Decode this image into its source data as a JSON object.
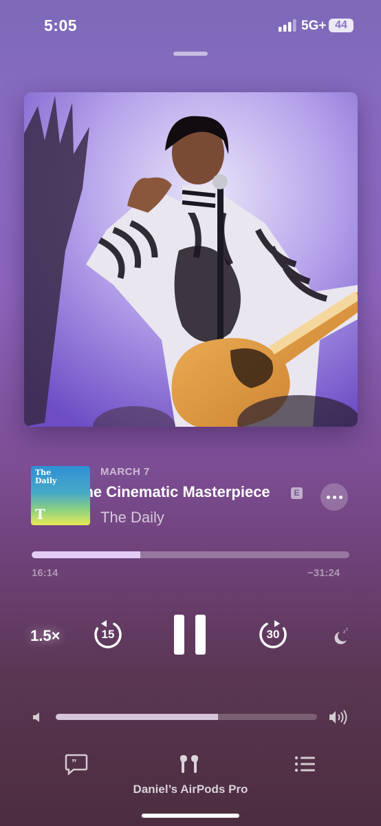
{
  "status_bar": {
    "time": "5:05",
    "network": "5G+",
    "battery": "44",
    "icons": [
      "signal-bars-icon",
      "battery-icon"
    ]
  },
  "artwork": {
    "description_icon": "album-artwork-image"
  },
  "episode": {
    "date": "MARCH 7",
    "title": "The Cinematic Masterpiece",
    "explicit_badge": "E",
    "show": "The Daily",
    "thumbnail_title": "The\nDaily",
    "thumbnail_logo": "T"
  },
  "progress": {
    "elapsed": "16:14",
    "remaining": "−31:24",
    "fraction": 0.341
  },
  "controls": {
    "speed": "1.5×",
    "skip_back": "15",
    "skip_forward": "30",
    "icons": [
      "skip-back-15-icon",
      "pause-icon",
      "skip-forward-30-icon",
      "sleep-timer-icon",
      "more-icon"
    ]
  },
  "volume": {
    "level": 0.62,
    "icons": [
      "volume-low-icon",
      "volume-high-icon"
    ]
  },
  "bottom_bar": {
    "device": "Daniel’s AirPods Pro",
    "icons": [
      "transcript-icon",
      "airpods-icon",
      "queue-list-icon"
    ]
  },
  "colors": {
    "background_top": "#7c69b8",
    "background_bottom": "#4c2d3f",
    "accent": "#ffffff"
  }
}
